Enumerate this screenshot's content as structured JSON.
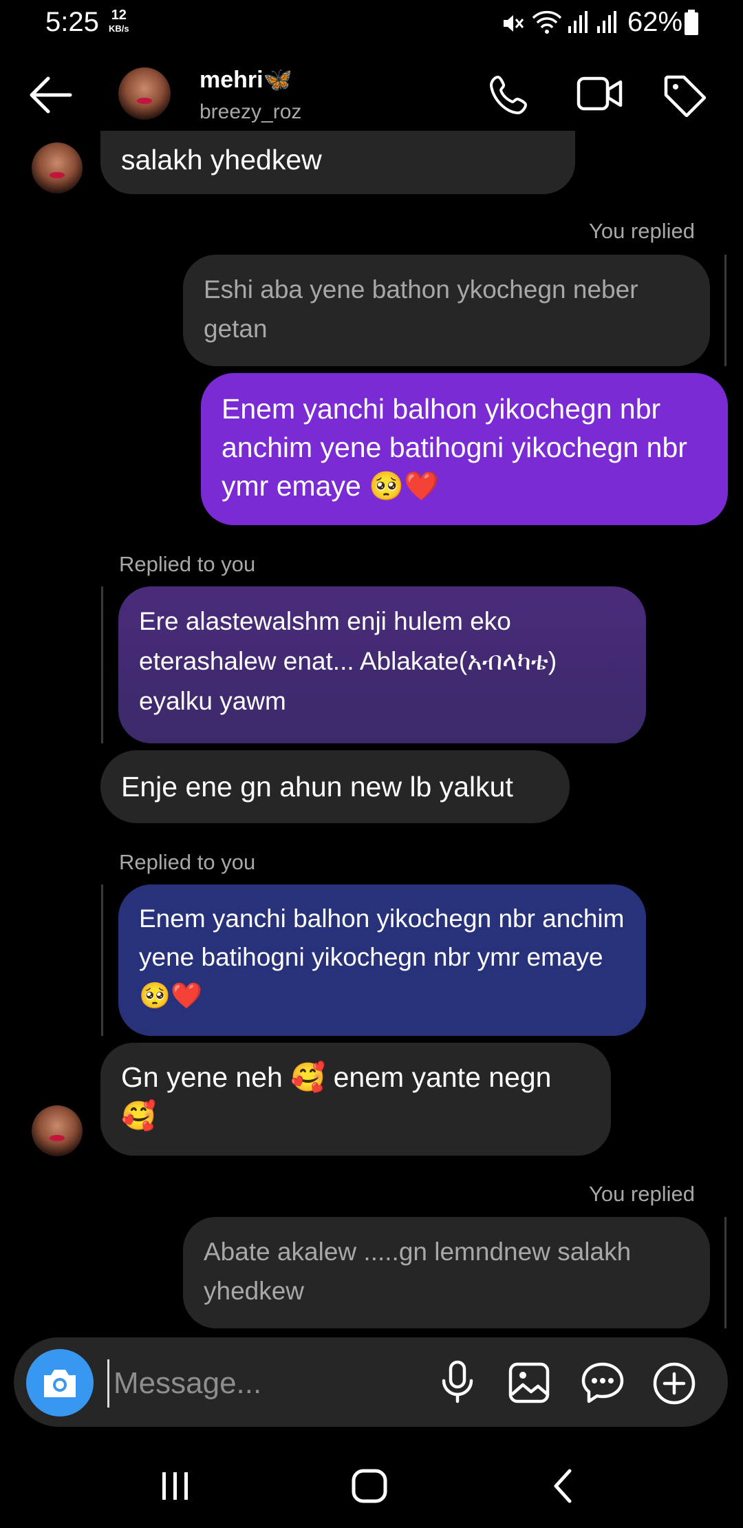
{
  "status_bar": {
    "time": "5:25",
    "net_speed_value": "12",
    "net_speed_unit": "KB/s",
    "battery": "62%"
  },
  "header": {
    "name": "mehri🦋",
    "username": "breezy_roz"
  },
  "messages": {
    "m1": "salakh yhedkew",
    "you_replied_1": "You replied",
    "reply1_quote": "Eshi aba yene bathon ykochegn neber getan",
    "sent1": "Enem yanchi balhon yikochegn nbr anchim yene batihogni yikochegn nbr ymr emaye 🥺❤️",
    "replied_to_you_1": "Replied to you",
    "quote1": "Ere alastewalshm enji hulem eko eterashalew enat... Ablakate(አብላካቴ) eyalku yawm",
    "m2": "Enje ene gn ahun new lb yalkut",
    "replied_to_you_2": "Replied to you",
    "quote2": "Enem yanchi balhon yikochegn nbr anchim yene batihogni yikochegn nbr ymr emaye 🥺❤️",
    "m3": "Gn yene neh 🥰 enem yante negn 🥰",
    "you_replied_2": "You replied",
    "reply2_quote": "Abate akalew .....gn lemndnew salakh yhedkew"
  },
  "composer": {
    "placeholder": "Message..."
  },
  "icons": {
    "back": "arrow-left-icon",
    "call": "phone-icon",
    "video": "video-camera-icon",
    "tag": "tag-icon",
    "camera": "camera-icon",
    "mic": "microphone-icon",
    "gallery": "image-icon",
    "sticker": "chat-sticker-icon",
    "plus": "plus-circle-icon"
  },
  "colors": {
    "background": "#000000",
    "bubble_gray": "#262626",
    "sent_purple": "#7b2bd4",
    "camera_blue": "#3897f0"
  }
}
